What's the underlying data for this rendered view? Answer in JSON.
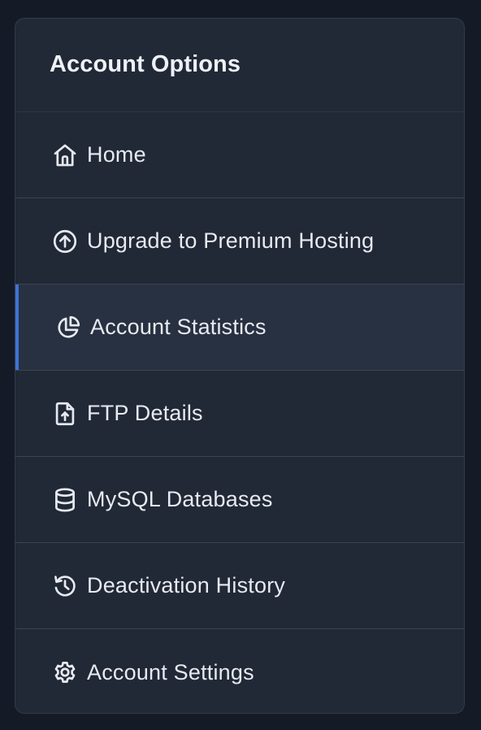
{
  "panel": {
    "title": "Account Options"
  },
  "menu": {
    "items": [
      {
        "label": "Home",
        "icon": "home-icon",
        "active": false
      },
      {
        "label": "Upgrade to Premium Hosting",
        "icon": "arrow-up-circle-icon",
        "active": false
      },
      {
        "label": "Account Statistics",
        "icon": "pie-chart-icon",
        "active": true
      },
      {
        "label": "FTP Details",
        "icon": "file-upload-icon",
        "active": false
      },
      {
        "label": "MySQL Databases",
        "icon": "database-icon",
        "active": false
      },
      {
        "label": "Deactivation History",
        "icon": "history-icon",
        "active": false
      },
      {
        "label": "Account Settings",
        "icon": "gear-icon",
        "active": false
      }
    ]
  },
  "colors": {
    "background": "#151b26",
    "panel": "#212836",
    "active_row": "#283141",
    "accent": "#3d74d6",
    "text": "#e7eaf0"
  }
}
